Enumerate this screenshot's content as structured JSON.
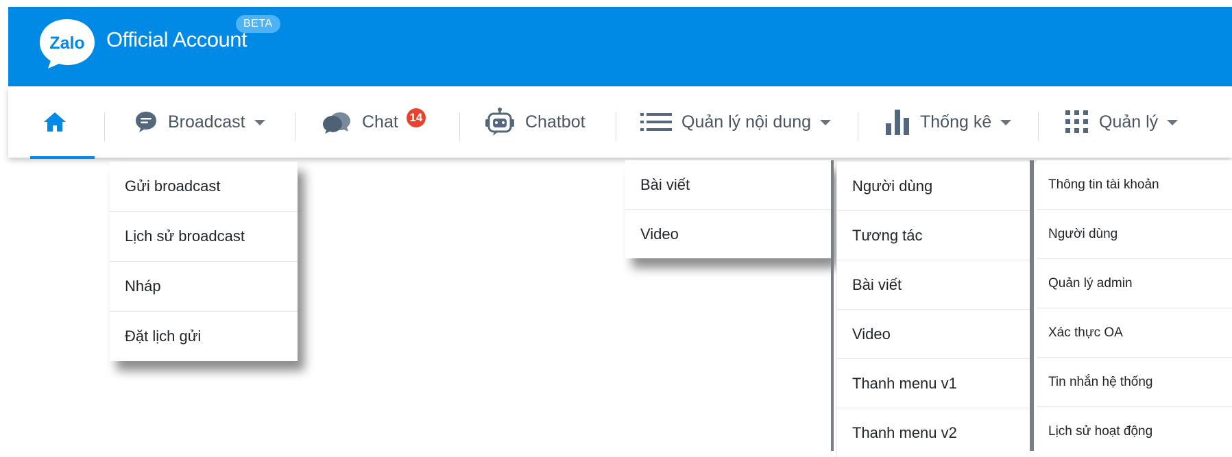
{
  "header": {
    "logo_text": "Zalo",
    "title": "Official Account",
    "badge": "BETA",
    "colors": {
      "brand": "#0189e6",
      "beta_bg": "#4db3f5"
    }
  },
  "nav": {
    "home_icon": "home-icon",
    "items": [
      {
        "label": "Broadcast",
        "icon": "message-bubble-icon",
        "has_caret": true
      },
      {
        "label": "Chat",
        "icon": "chat-bubbles-icon",
        "badge": "14"
      },
      {
        "label": "Chatbot",
        "icon": "robot-icon"
      },
      {
        "label": "Quản lý nội dung",
        "icon": "list-icon",
        "has_caret": true
      },
      {
        "label": "Thống kê",
        "icon": "bar-chart-icon",
        "has_caret": true
      },
      {
        "label": "Quản lý",
        "icon": "grid-dots-icon",
        "has_caret": true
      }
    ],
    "badge_color": "#e8432e"
  },
  "dropdowns": {
    "broadcast": [
      "Gửi broadcast",
      "Lịch sử broadcast",
      "Nháp",
      "Đặt lịch gửi"
    ],
    "quan_ly_noi_dung": [
      "Bài viết",
      "Video"
    ],
    "thong_ke": [
      "Người dùng",
      "Tương tác",
      "Bài viết",
      "Video",
      "Thanh menu v1",
      "Thanh menu v2"
    ],
    "quan_ly": [
      "Thông tin tài khoản",
      "Người dùng",
      "Quản lý admin",
      "Xác thực OA",
      "Tin nhắn hệ thống",
      "Lịch sử hoạt động"
    ]
  }
}
